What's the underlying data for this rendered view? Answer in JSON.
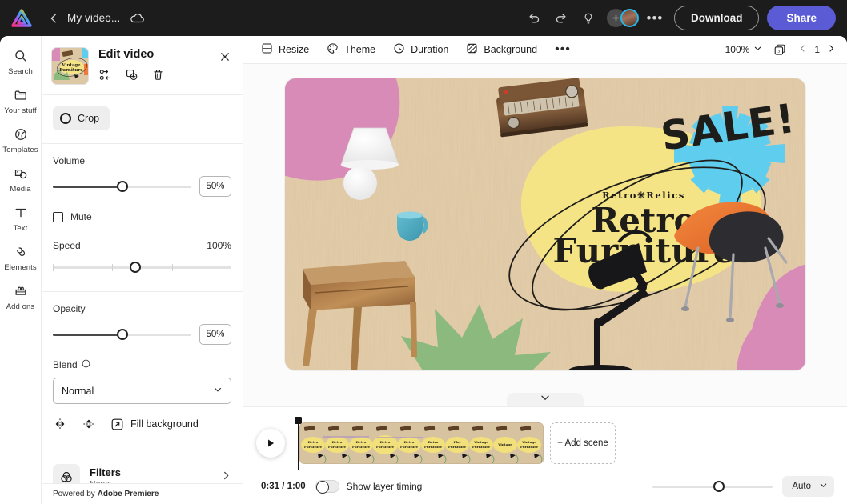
{
  "topbar": {
    "logo_icon": "adobe-express-logo",
    "back_icon": "chevron-left-icon",
    "doc_title": "My video...",
    "cloud_icon": "cloud-saved-icon",
    "undo_icon": "undo-icon",
    "redo_icon": "redo-icon",
    "ideas_icon": "lightbulb-icon",
    "add_collaborator_icon": "plus-icon",
    "avatar_icon": "avatar",
    "more_icon": "more-options-icon",
    "download_label": "Download",
    "share_label": "Share",
    "share_color": "#5b5bd6"
  },
  "rail": {
    "items": [
      {
        "label": "Search",
        "icon": "search-icon"
      },
      {
        "label": "Your stuff",
        "icon": "folder-icon"
      },
      {
        "label": "Templates",
        "icon": "templates-icon"
      },
      {
        "label": "Media",
        "icon": "media-icon"
      },
      {
        "label": "Text",
        "icon": "text-icon"
      },
      {
        "label": "Elements",
        "icon": "elements-icon"
      },
      {
        "label": "Add ons",
        "icon": "addons-icon"
      }
    ]
  },
  "panel": {
    "title": "Edit video",
    "close_icon": "close-icon",
    "thumbnail_alt": "Retro Furniture video thumbnail",
    "actions": [
      {
        "name": "replace-media-icon",
        "icon": "replace-media-icon"
      },
      {
        "name": "duplicate-icon",
        "icon": "duplicate-icon"
      },
      {
        "name": "delete-icon",
        "icon": "trash-icon"
      }
    ],
    "crop_label": "Crop",
    "volume": {
      "label": "Volume",
      "value": "50%",
      "percent": 50
    },
    "mute": {
      "label": "Mute",
      "checked": false
    },
    "speed": {
      "label": "Speed",
      "value": "100%",
      "percent": 46
    },
    "opacity": {
      "label": "Opacity",
      "value": "50%",
      "percent": 50
    },
    "blend": {
      "label": "Blend",
      "info_icon": "info-icon",
      "selected": "Normal",
      "options": [
        "Normal"
      ]
    },
    "tools": [
      {
        "name": "flip-horizontal-icon",
        "icon": "flip-horizontal-icon"
      },
      {
        "name": "flip-vertical-icon",
        "icon": "flip-vertical-icon"
      }
    ],
    "fill_background_label": "Fill background",
    "fill_background_icon": "fill-background-icon",
    "filters": {
      "icon": "filters-icon",
      "title": "Filters",
      "subtitle": "None",
      "chevron": "chevron-right-icon"
    },
    "footer": {
      "prefix": "Powered by ",
      "brand": "Adobe Premiere"
    }
  },
  "canvas_toolbar": {
    "items": [
      {
        "label": "Resize",
        "icon": "resize-icon"
      },
      {
        "label": "Theme",
        "icon": "palette-icon"
      },
      {
        "label": "Duration",
        "icon": "clock-icon"
      },
      {
        "label": "Background",
        "icon": "background-icon"
      }
    ],
    "more_icon": "more-options-icon",
    "zoom_level": "100%",
    "zoom_chevron": "chevron-down-icon",
    "pages_icon": "pages-icon",
    "page_prev_icon": "chevron-left-icon",
    "page_number": "1",
    "page_next_icon": "chevron-right-icon"
  },
  "artwork": {
    "headline_kicker": "Retro✳Relics",
    "headline_line1": "Retro",
    "headline_line2": "Furniture",
    "sale_badge": "SALE!",
    "colors": {
      "paper": "#e3cba6",
      "pink": "#d98bb8",
      "yellow": "#f5e486",
      "cyan": "#5fcdee",
      "green": "#8cba7e",
      "orange": "#f07a3c",
      "ink": "#1f1d1a"
    }
  },
  "timeline": {
    "collapse_icon": "chevron-down-icon",
    "play_icon": "play-icon",
    "clip_label": "Retro Furniture scene",
    "add_scene_label": "+ Add scene",
    "time_current": "0:31",
    "time_total": "1:00",
    "time_display": "0:31 / 1:00",
    "show_layer_timing_label": "Show layer timing",
    "show_layer_timing_on": false,
    "zoom_percent": 55,
    "fit_label": "Auto",
    "fit_chevron": "chevron-down-icon"
  }
}
